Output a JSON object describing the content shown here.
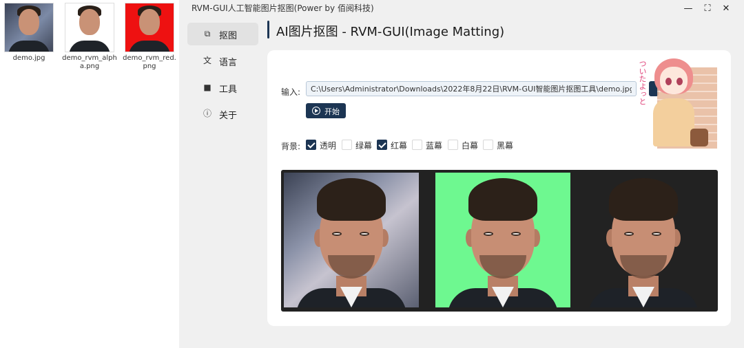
{
  "files": [
    {
      "name": "demo.jpg"
    },
    {
      "name": "demo_rvm_alpha.png"
    },
    {
      "name": "demo_rvm_red.png"
    }
  ],
  "window": {
    "title": "RVM-GUI人工智能图片抠图(Power by 佰阅科技)",
    "controls": {
      "minimize": "—",
      "maximize": "⛶",
      "close": "✕"
    }
  },
  "nav": {
    "items": [
      {
        "label": "抠图",
        "icon": "image-cut-icon",
        "active": true
      },
      {
        "label": "语言",
        "icon": "translate-icon"
      },
      {
        "label": "工具",
        "icon": "toolbox-icon"
      },
      {
        "label": "关于",
        "icon": "info-icon"
      }
    ]
  },
  "page": {
    "title": "AI图片抠图 - RVM-GUI(Image Matting)"
  },
  "form": {
    "input_label": "输入:",
    "input_value": "C:\\Users\\Administrator\\Downloads\\2022年8月22日\\RVM-GUI智能图片抠图工具\\demo.jpg",
    "start_label": "开始",
    "background_label": "背景:",
    "options": [
      {
        "label": "透明",
        "checked": true
      },
      {
        "label": "绿幕",
        "checked": false
      },
      {
        "label": "红幕",
        "checked": true
      },
      {
        "label": "蓝幕",
        "checked": false
      },
      {
        "label": "白幕",
        "checked": false
      },
      {
        "label": "黑幕",
        "checked": false
      }
    ]
  },
  "mascot": {
    "text": "ついたよっと"
  },
  "preview": {
    "images": [
      {
        "name": "original",
        "background": "#8c93a9"
      },
      {
        "name": "green-screen",
        "background": "#6ef890"
      },
      {
        "name": "transparent",
        "background": "#222222"
      }
    ]
  },
  "colors": {
    "accent": "#1c3553",
    "card": "#ffffff",
    "window": "#f0f0f0"
  }
}
